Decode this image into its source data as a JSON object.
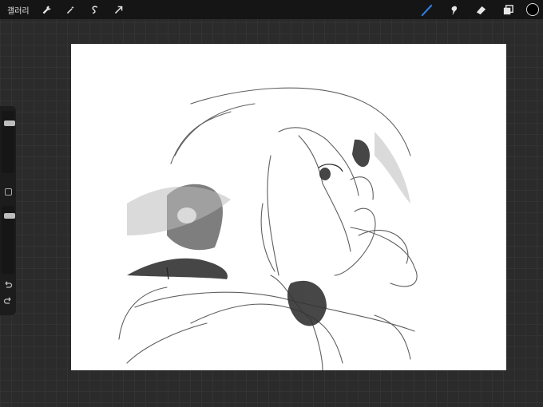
{
  "app": {
    "gallery_label": "갤러리",
    "left_tools": [
      "wrench-icon",
      "magic-wand-icon",
      "selection-icon",
      "transform-arrow-icon"
    ],
    "right_tools": [
      "brush-icon",
      "smudge-icon",
      "eraser-icon",
      "layers-icon"
    ],
    "active_tool": "brush",
    "accent_color": "#2f7fe6",
    "current_color": "#000000"
  },
  "sidebar": {
    "brush_size_level": 0.85,
    "opacity_level": 0.9,
    "controls": [
      "brush-size-slider",
      "modify-button",
      "opacity-slider",
      "undo-button",
      "redo-button"
    ]
  },
  "canvas": {
    "content": "sketch-drawing",
    "background": "#ffffff"
  }
}
